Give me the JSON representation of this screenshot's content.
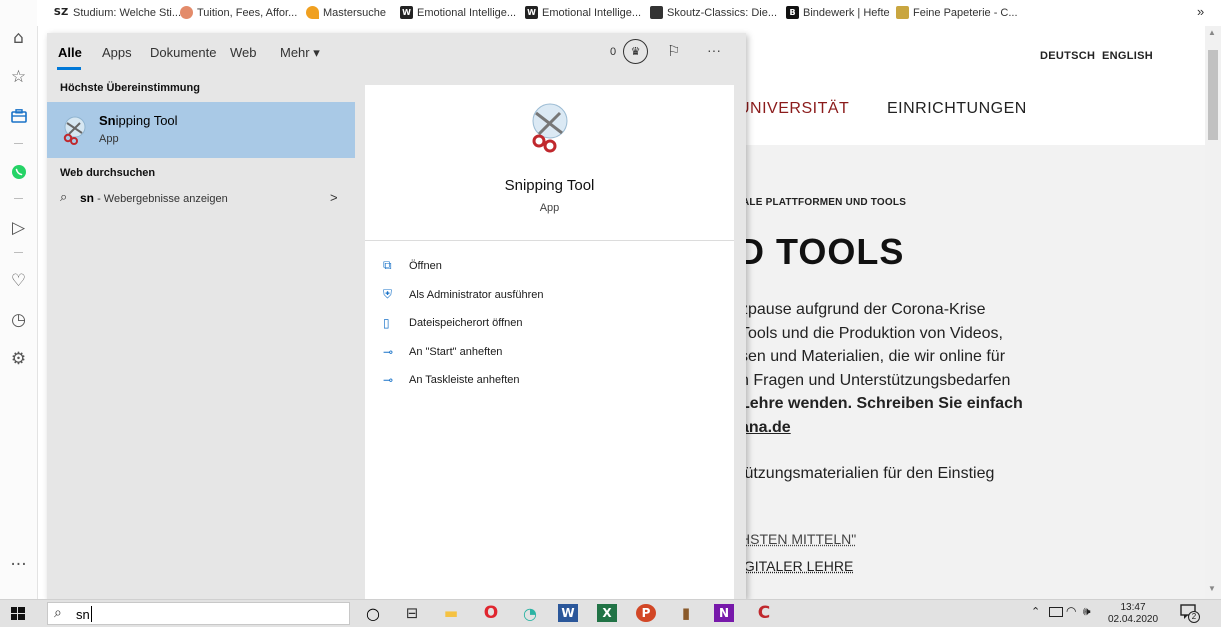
{
  "bookmarks": [
    {
      "label": "Studium: Welche Sti...",
      "icon": "sz-favicon",
      "text": "SZ",
      "color": "#222222"
    },
    {
      "label": "Tuition, Fees, Affor...",
      "icon": "globe-favicon",
      "text": "",
      "color": "#e38b6a"
    },
    {
      "label": "Mastersuche",
      "icon": "mastersuche-favicon",
      "text": "",
      "color": "#f0a020"
    },
    {
      "label": "Emotional Intellige...",
      "icon": "w-favicon",
      "text": "W",
      "color": "#222222"
    },
    {
      "label": "Emotional Intellige...",
      "icon": "w-favicon",
      "text": "W",
      "color": "#222222"
    },
    {
      "label": "Skoutz-Classics: Die...",
      "icon": "skoutz-favicon",
      "text": "",
      "color": "#333333"
    },
    {
      "label": "Bindewerk | Hefte",
      "icon": "b-favicon",
      "text": "B",
      "color": "#111111"
    },
    {
      "label": "Feine Papeterie - C...",
      "icon": "building-favicon",
      "text": "",
      "color": "#c9a640"
    }
  ],
  "bookmarks_more": "»",
  "sidebar_icons": [
    "home-icon",
    "star-icon",
    "briefcase-icon",
    "whatsapp-icon",
    "send-icon",
    "heart-icon",
    "history-icon",
    "settings-icon",
    "more-icon"
  ],
  "search_panel": {
    "tabs": [
      "Alle",
      "Apps",
      "Dokumente",
      "Web",
      "Mehr ▾"
    ],
    "active_tab": "Alle",
    "points": "0",
    "more_dots": "···",
    "best_match_title": "Höchste Übereinstimmung",
    "best_match": {
      "name_bold": "Sn",
      "name_rest": "ipping Tool",
      "type": "App"
    },
    "web_title": "Web durchsuchen",
    "web_result": {
      "query": "sn",
      "suffix": " - Webergebnisse anzeigen",
      "arrow": ">"
    },
    "preview": {
      "name": "Snipping Tool",
      "type": "App"
    },
    "actions": [
      {
        "icon": "open-icon",
        "label": "Öffnen"
      },
      {
        "icon": "admin-icon",
        "label": "Als Administrator ausführen"
      },
      {
        "icon": "folder-icon",
        "label": "Dateispeicherort öffnen"
      },
      {
        "icon": "pin-icon",
        "label": "An \"Start\" anheften"
      },
      {
        "icon": "pin-icon",
        "label": "An Taskleiste anheften"
      }
    ]
  },
  "webpage": {
    "lang_de": "DEUTSCH",
    "lang_en": "ENGLISH",
    "nav": [
      "UNIVERSITÄT",
      "EINRICHTUNGEN"
    ],
    "breadcrumb": "ALE PLATTFORMEN UND TOOLS",
    "heading": "D TOOLS",
    "para_lines": [
      "zpause aufgrund der Corona-Krise",
      "Tools und die Produktion von Videos,",
      "sen und Materialien, die wir online für",
      "n Fragen und Unterstützungsbedarfen",
      "Lehre wenden. Schreiben Sie einfach",
      "ana.de"
    ],
    "para2": "tützungsmaterialien für den Einstieg",
    "link1": "HSTEN MITTELN\"",
    "link2": "IGITALER LEHRE"
  },
  "taskbar": {
    "search_text": "sn",
    "apps": [
      {
        "name": "cortana-icon",
        "text": "○",
        "color": "#000000"
      },
      {
        "name": "task-view-icon",
        "text": "⊟",
        "color": "#333333"
      },
      {
        "name": "file-explorer-icon",
        "text": "▬",
        "color": "#f5c242"
      },
      {
        "name": "opera-icon",
        "text": "O",
        "color": "#e0262f"
      },
      {
        "name": "browser-icon",
        "text": "◔",
        "color": "#2bb3a3"
      },
      {
        "name": "word-icon",
        "text": "W",
        "color": "#2b579a"
      },
      {
        "name": "excel-icon",
        "text": "X",
        "color": "#217346"
      },
      {
        "name": "powerpoint-icon",
        "text": "P",
        "color": "#d24726"
      },
      {
        "name": "books-icon",
        "text": "▮",
        "color": "#8a5a2b"
      },
      {
        "name": "onenote-icon",
        "text": "N",
        "color": "#7719aa"
      },
      {
        "name": "app-c-icon",
        "text": "C",
        "color": "#c0282d"
      }
    ],
    "time": "13:47",
    "date": "02.04.2020",
    "notification_count": "2"
  }
}
